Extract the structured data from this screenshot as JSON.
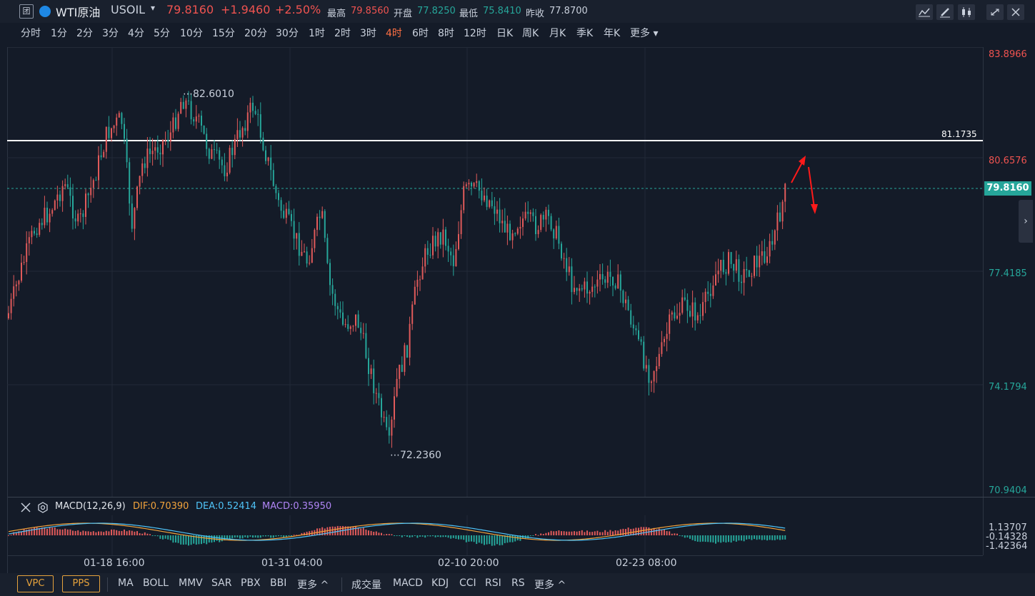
{
  "header": {
    "symbol_name": "WTI原油",
    "ticker": "USOIL",
    "price": "79.8160",
    "change": "+1.9460",
    "change_pct": "+2.50%",
    "high_label": "最高",
    "high_value": "79.8560",
    "open_label": "开盘",
    "open_value": "77.8250",
    "low_label": "最低",
    "low_value": "75.8410",
    "prev_label": "昨收",
    "prev_value": "77.8700"
  },
  "timeframes": [
    "分时",
    "1分",
    "2分",
    "3分",
    "4分",
    "5分",
    "10分",
    "15分",
    "20分",
    "30分",
    "1时",
    "2时",
    "3时",
    "4时",
    "6时",
    "8时",
    "12时",
    "日K",
    "周K",
    "月K",
    "季K",
    "年K",
    "更多"
  ],
  "active_timeframe": "4时",
  "price_axis": [
    "83.8966",
    "80.6576",
    "77.4185",
    "74.1794",
    "70.9404"
  ],
  "current_price_tag": "79.8160",
  "hline_value": "81.1735",
  "max_marker": "82.6010",
  "min_marker": "72.2360",
  "macd": {
    "title": "MACD(12,26,9)",
    "dif": "DIF:0.70390",
    "dea": "DEA:0.52414",
    "macd": "MACD:0.35950",
    "axis": [
      "1.13707",
      "-0.14328",
      "-1.42364"
    ]
  },
  "x_labels": [
    "01-18 16:00",
    "01-31 04:00",
    "02-10 20:00",
    "02-23 08:00"
  ],
  "bottom": {
    "vpc": "VPC",
    "pps": "PPS",
    "main_indicators": [
      "MA",
      "BOLL",
      "MMV",
      "SAR",
      "PBX",
      "BBI"
    ],
    "more1": "更多",
    "sub_indicators": [
      "成交量",
      "MACD",
      "KDJ",
      "CCI",
      "RSI",
      "RS"
    ],
    "more2": "更多"
  },
  "colors": {
    "up": "#e05a5a",
    "down": "#26a69a",
    "bg": "#141b28",
    "accent": "#ff7043"
  }
}
